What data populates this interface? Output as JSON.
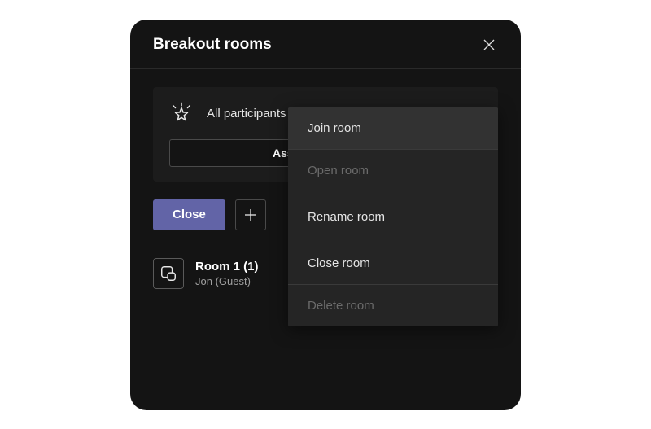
{
  "header": {
    "title": "Breakout rooms"
  },
  "info": {
    "banner_text": "All participants are assigned",
    "assign_label": "Assign participants"
  },
  "actions": {
    "close_label": "Close"
  },
  "rooms": [
    {
      "name": "Room 1 (1)",
      "participants": "Jon (Guest)"
    }
  ],
  "context_menu": {
    "join": "Join room",
    "open": "Open room",
    "rename": "Rename room",
    "close": "Close room",
    "delete": "Delete room"
  },
  "colors": {
    "accent": "#6264a7",
    "panel_bg": "#141414",
    "menu_bg": "#252525"
  }
}
